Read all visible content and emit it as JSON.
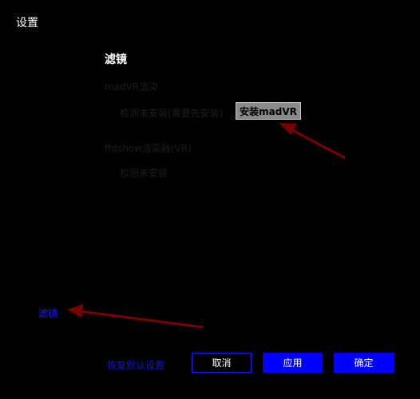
{
  "window": {
    "title": "设置"
  },
  "section": {
    "title": "滤镜"
  },
  "madvr": {
    "group_label": "madVR渲染",
    "status": "检测未安装(需要先安装)",
    "install_label": "安装madVR"
  },
  "ffdshow": {
    "group_label": "ffdshow渲染器(VR)",
    "status": "检测未安装"
  },
  "nav": {
    "filter_label": "滤镜"
  },
  "footer": {
    "reset_label": "恢复默认设置",
    "cancel_label": "取消",
    "apply_label": "应用",
    "ok_label": "确定"
  },
  "colors": {
    "accent": "#0000ff",
    "annotation_arrow": "#7a0000"
  }
}
